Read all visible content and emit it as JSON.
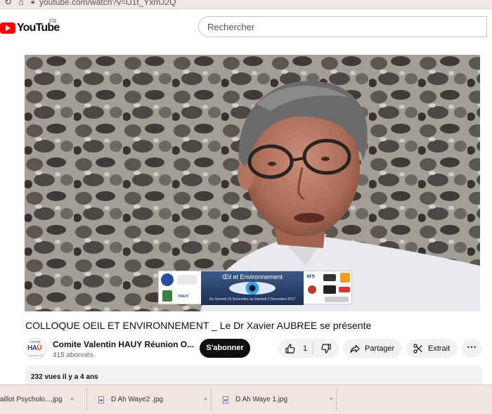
{
  "browser": {
    "url": "youtube.com/watch?v=lJ1t_YxmJ2Q"
  },
  "header": {
    "logo_text": "YouTube",
    "country": "FR",
    "search_placeholder": "Rechercher"
  },
  "video": {
    "banner_title": "Œil et Environnement",
    "banner_subtitle": "Du Samedi 25 Novembre au Samedi 2 Décembre 2017",
    "banner_left_label": "HAUY",
    "banner_right_label": "ars"
  },
  "title": "COLLOQUE OEIL ET ENVIRONNEMENT _ Le Dr Xavier AUBREE se présente",
  "channel": {
    "avatar_top": "comité",
    "avatar_mid_a": "HA",
    "avatar_mid_b": "Ü",
    "avatar_bottom": "Valentin Haüy",
    "name": "Comite Valentin HAUY Réunion O...",
    "subscribers": "415 abonnés",
    "subscribe_label": "S'abonner"
  },
  "actions": {
    "like_count": "1",
    "share_label": "Partager",
    "clip_label": "Extrait",
    "more_label": "⋯"
  },
  "description": {
    "meta": "232 vues  il y a 4 ans"
  },
  "downloads": [
    {
      "name": "aillot Psycholo....jpg"
    },
    {
      "name": "D Ah Waye2 .jpg"
    },
    {
      "name": "D Ah Waye 1.jpg"
    }
  ],
  "colors": {
    "brand_red": "#ff0000",
    "subscribe_bg": "#0f0f0f",
    "pill_bg": "#f2f2f2"
  }
}
